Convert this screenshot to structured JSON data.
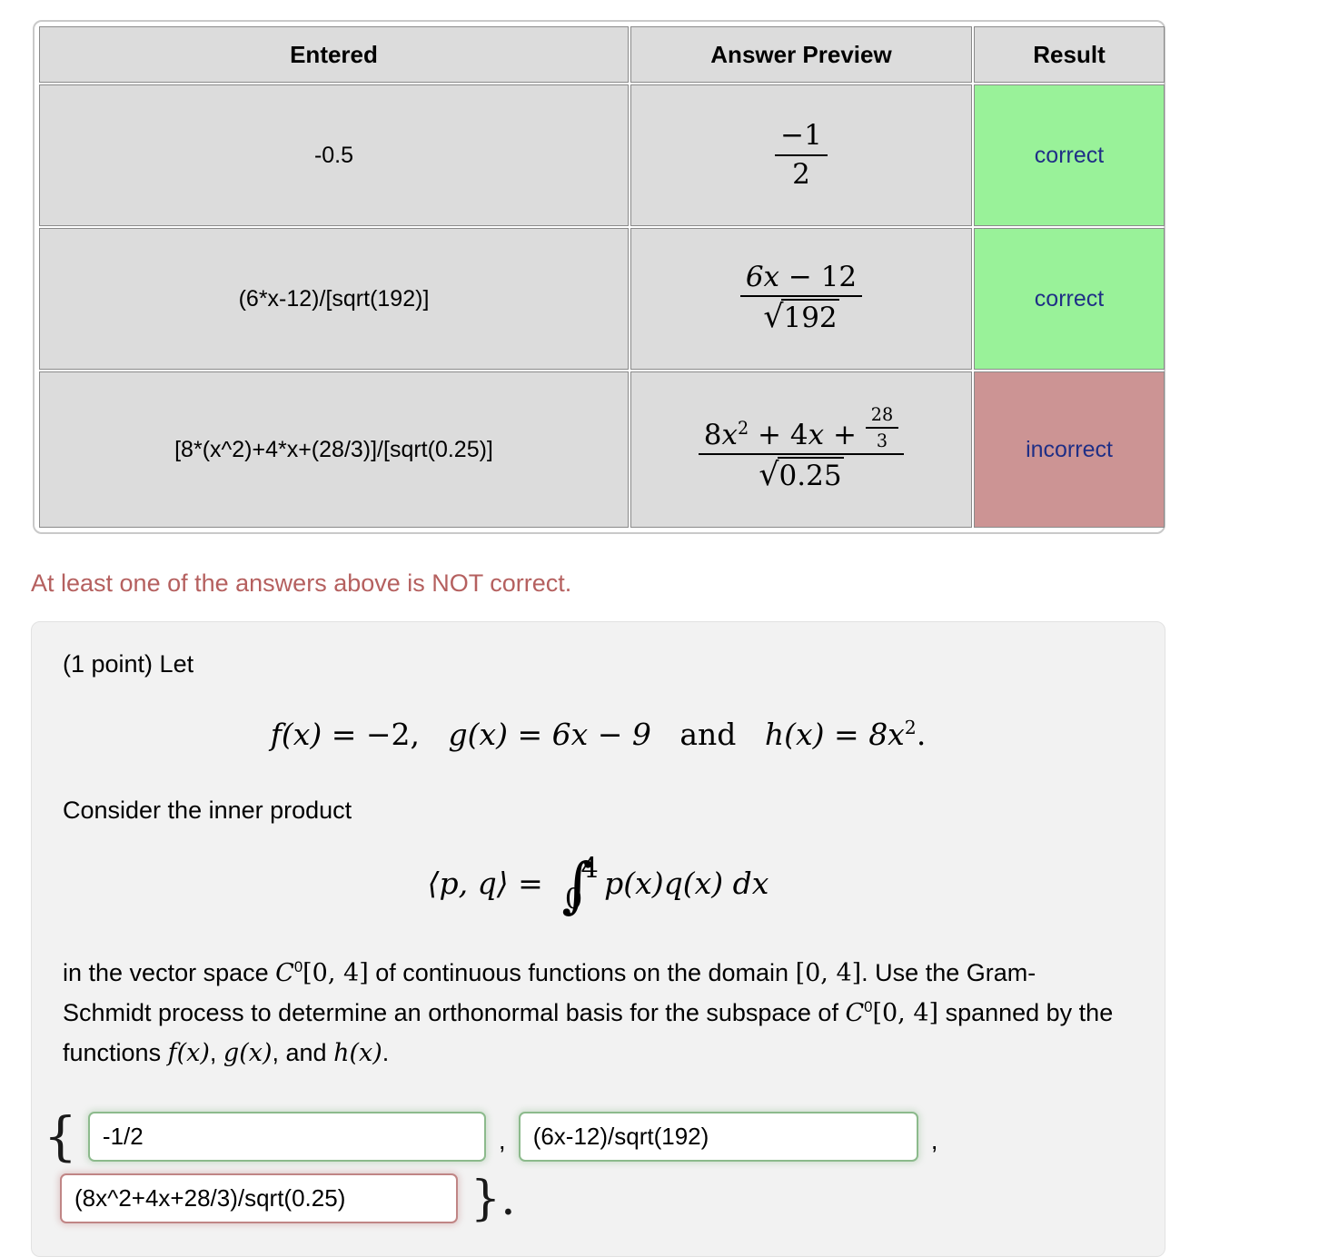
{
  "results_table": {
    "columns": [
      "Entered",
      "Answer Preview",
      "Result"
    ],
    "rows": [
      {
        "entered": "-0.5",
        "preview": {
          "numerator": "−1",
          "denominator": "2"
        },
        "result": "correct",
        "result_state": "correct"
      },
      {
        "entered": "(6*x-12)/[sqrt(192)]",
        "preview": {
          "numerator": "6x − 12",
          "denominator": "√192",
          "radicand": "192"
        },
        "result": "correct",
        "result_state": "correct"
      },
      {
        "entered": "[8*(x^2)+4*x+(28/3)]/[sqrt(0.25)]",
        "preview": {
          "numerator": "8x² + 4x + 28/3",
          "inner_fraction_num": "28",
          "inner_fraction_den": "3",
          "denominator": "√0.25",
          "radicand": "0.25"
        },
        "result": "incorrect",
        "result_state": "incorrect"
      }
    ]
  },
  "warning": {
    "text": "At least one of the answers above is NOT correct."
  },
  "problem": {
    "point_line": "(1 point) Let",
    "definitions": {
      "f_label": "f(x)",
      "f_value": "−2,",
      "g_label": "g(x)",
      "g_value": "6x − 9",
      "and_word": "and",
      "h_label": "h(x)",
      "h_value": "8x",
      "h_exp": "2",
      "period": "."
    },
    "consider_line": "Consider the inner product",
    "inner_product": {
      "lhs": "⟨p, q⟩",
      "equals": "=",
      "upper_limit": "4",
      "lower_limit": "0",
      "integrand": "p(x)q(x) dx"
    },
    "paragraph": {
      "part1": "in the vector space",
      "space_sym": "C",
      "space_exp": "0",
      "interval": "[0, 4]",
      "part2": "of continuous functions on the domain",
      "interval2": "[0, 4]",
      "part3": ". Use the Gram-Schmidt process to determine an orthonormal basis for the subspace of",
      "space_sym2": "C",
      "space_exp2": "0",
      "interval3": "[0, 4]",
      "part4": "spanned by the functions",
      "fn1": "f(x)",
      "fn2": "g(x)",
      "and_word": ", and",
      "fn3": "h(x)",
      "period": "."
    }
  },
  "answers": {
    "open_brace": "{",
    "close_brace": "}.",
    "comma1": ",",
    "comma2": ",",
    "field1": {
      "value": "-1/2",
      "state": "correct"
    },
    "field2": {
      "value": "(6x-12)/sqrt(192)",
      "state": "correct"
    },
    "field3": {
      "value": "(8x^2+4x+28/3)/sqrt(0.25)",
      "state": "incorrect"
    }
  },
  "colors": {
    "correct_bg": "#99f299",
    "incorrect_bg": "#cc9494",
    "result_text": "#1f2f86",
    "warning_text": "#b5605f",
    "cell_bg": "#dcdcdc",
    "panel_bg": "#f2f2f2",
    "input_ok_border": "#8cba8c",
    "input_bad_border": "#c08585"
  }
}
